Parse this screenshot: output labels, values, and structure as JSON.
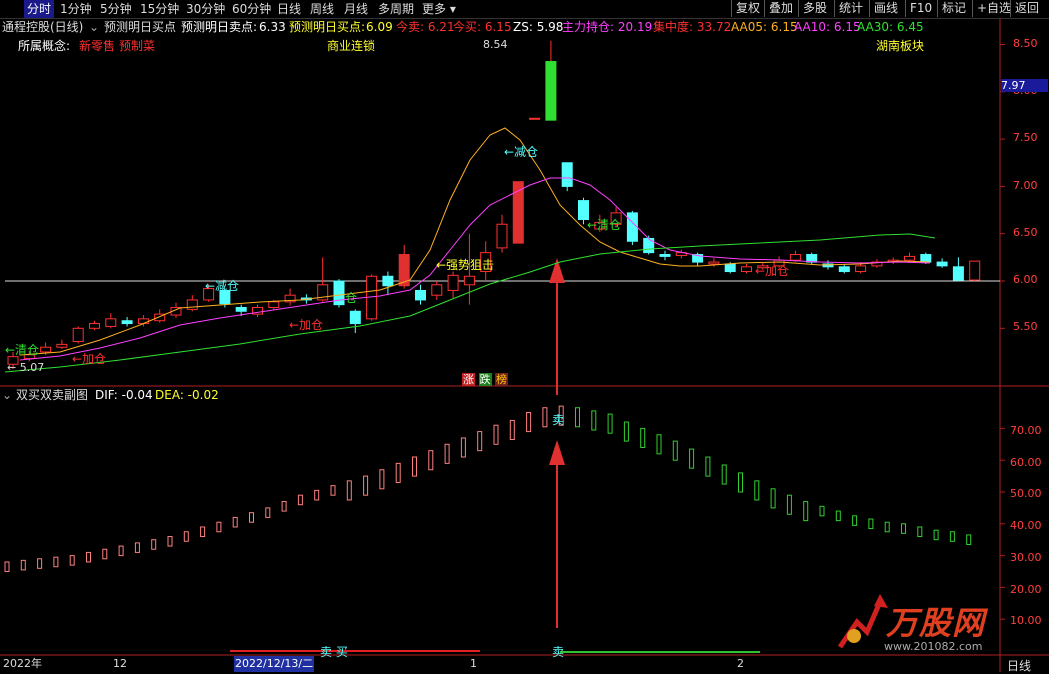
{
  "toolbar": {
    "tabs": [
      "分时",
      "1分钟",
      "5分钟",
      "15分钟",
      "30分钟",
      "60分钟",
      "日线",
      "周线",
      "月线",
      "多周期",
      "更多"
    ],
    "right_buttons": [
      "复权",
      "叠加",
      "多股",
      "统计",
      "画线",
      "F10",
      "标记",
      "+自选",
      "返回"
    ]
  },
  "info": {
    "stock_name": "通程控股(日线)",
    "sell_point_label": "预测明日买点",
    "sell_pred_label": "预测明日卖点:",
    "sell_pred_value": "6.33",
    "buy_pred_label": "预测明日买点:",
    "buy_pred_value": "6.09",
    "today_sell": "今卖: 6.21",
    "today_buy": "今买: 6.15",
    "zs": "ZS: 5.98",
    "main_pos": "主力持仓: 20.19",
    "concentration": "集中度: 33.72",
    "aa05": "AA05: 6.15",
    "aa10": "AA10: 6.15",
    "aa30": "AA30: 6.45"
  },
  "concepts": {
    "label": "所属概念:",
    "items": [
      "新零售",
      "预制菜"
    ],
    "middle": "商业连锁",
    "right": "湖南板块"
  },
  "price_axis": {
    "ticks": [
      "8.50",
      "8.00",
      "7.50",
      "7.00",
      "6.50",
      "6.00",
      "5.50"
    ],
    "current": "7.97"
  },
  "annotations": {
    "high": "8.54",
    "low": "5.07",
    "qingcang1": "←清仓",
    "jiacang1": "←加仓",
    "jiancang1": "←减仓",
    "jiacang2": "←加仓",
    "cang": "仓",
    "jiancang2": "←减仓",
    "qiangshi": "←强势狙击",
    "qingcang2": "←清仓",
    "jiacang3": "←加仓"
  },
  "badges": [
    "涨",
    "跌",
    "榜"
  ],
  "sub": {
    "title": "双买双卖副图",
    "dif": "DIF: -0.04",
    "dea": "DEA: -0.02",
    "sell_label": "卖",
    "ticks": [
      "70.00",
      "60.00",
      "50.00",
      "40.00",
      "30.00",
      "20.00",
      "10.00"
    ]
  },
  "bottom": {
    "maimai": "卖 买",
    "mai": "卖"
  },
  "dates": {
    "y2022": "2022年",
    "m12": "12",
    "selected": "2022/12/13/二",
    "m1": "1",
    "m2": "2",
    "period": "日线"
  },
  "watermark": {
    "brand": "万股网",
    "url": "www.201082.com"
  },
  "colors": {
    "up": "#ff3030",
    "down": "#54ffff",
    "ma5": "#ffb020",
    "ma10": "#ff40ff",
    "ma30": "#30e030"
  }
}
